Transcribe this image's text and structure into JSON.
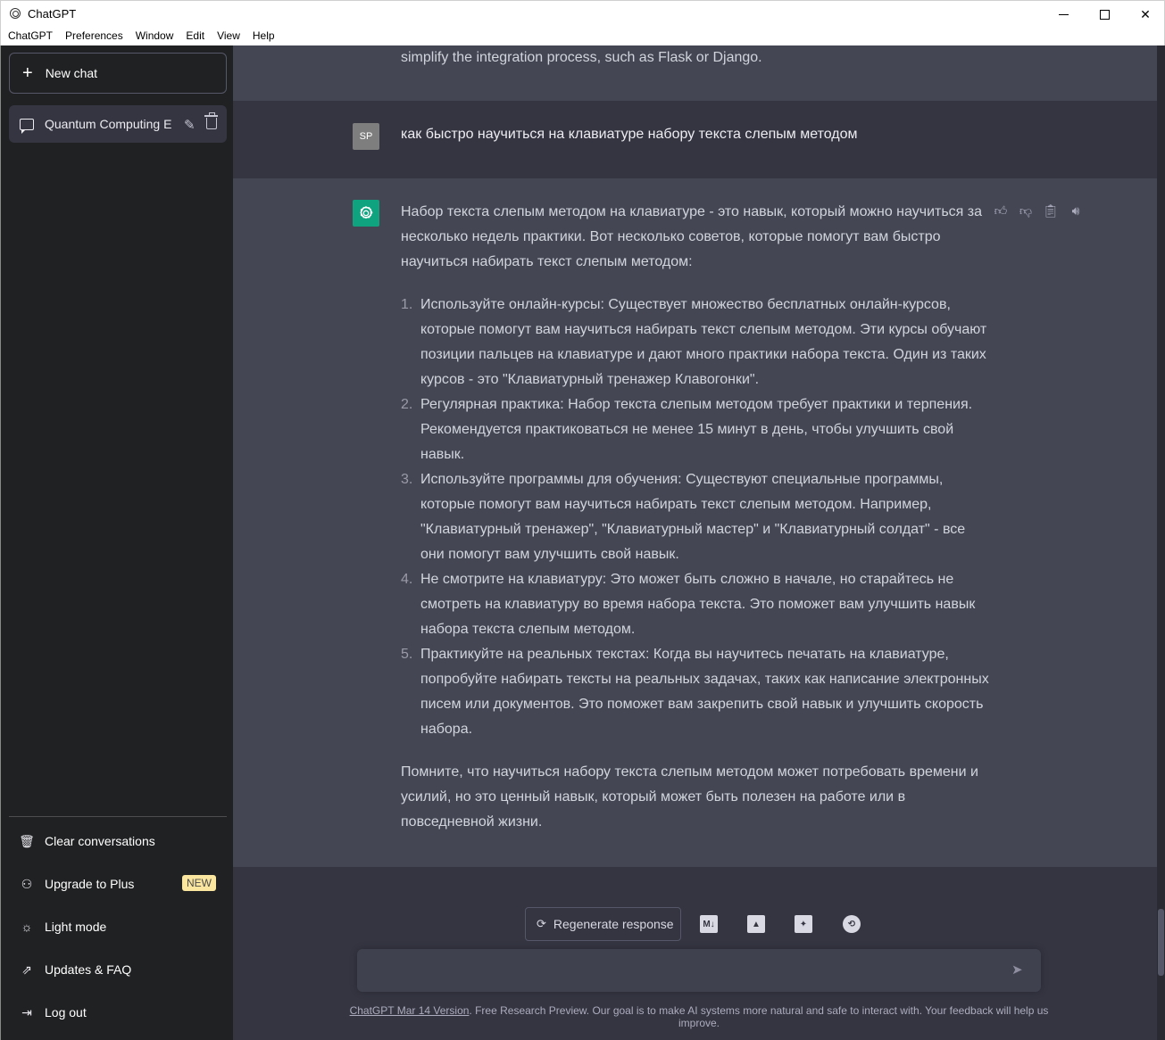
{
  "window": {
    "title": "ChatGPT"
  },
  "menu": [
    "ChatGPT",
    "Preferences",
    "Window",
    "Edit",
    "View",
    "Help"
  ],
  "sidebar": {
    "new_chat": "New chat",
    "chats": [
      {
        "label": "Quantum Computing E"
      }
    ],
    "links": [
      {
        "label": "Clear conversations",
        "icon": "trash-icon"
      },
      {
        "label": "Upgrade to Plus",
        "icon": "user-icon",
        "badge": "NEW"
      },
      {
        "label": "Light mode",
        "icon": "sun-icon"
      },
      {
        "label": "Updates & FAQ",
        "icon": "external-link-icon"
      },
      {
        "label": "Log out",
        "icon": "logout-icon"
      }
    ]
  },
  "conversation": {
    "prev_tail": "simplify the integration process, such as Flask or Django.",
    "user": {
      "avatar": "SP",
      "text": "как быстро научиться на клавиатуре набору текста слепым методом"
    },
    "assistant": {
      "intro": "Набор текста слепым методом на клавиатуре - это навык, который можно научиться за несколько недель практики. Вот несколько советов, которые помогут вам быстро научиться набирать текст слепым методом:",
      "items": [
        {
          "num": "1.",
          "text": "Используйте онлайн-курсы: Существует множество бесплатных онлайн-курсов, которые помогут вам научиться набирать текст слепым методом. Эти курсы обучают позиции пальцев на клавиатуре и дают много практики набора текста. Один из таких курсов - это \"Клавиатурный тренажер Клавогонки\"."
        },
        {
          "num": "2.",
          "text": "Регулярная практика: Набор текста слепым методом требует практики и терпения. Рекомендуется практиковаться не менее 15 минут в день, чтобы улучшить свой навык."
        },
        {
          "num": "3.",
          "text": "Используйте программы для обучения: Существуют специальные программы, которые помогут вам научиться набирать текст слепым методом. Например, \"Клавиатурный тренажер\", \"Клавиатурный мастер\" и \"Клавиатурный солдат\" - все они помогут вам улучшить свой навык."
        },
        {
          "num": "4.",
          "text": "Не смотрите на клавиатуру: Это может быть сложно в начале, но старайтесь не смотреть на клавиатуру во время набора текста. Это поможет вам улучшить навык набора текста слепым методом."
        },
        {
          "num": "5.",
          "text": "Практикуйте на реальных текстах: Когда вы научитесь печатать на клавиатуре, попробуйте набирать тексты на реальных задачах, таких как написание электронных писем или документов. Это поможет вам закрепить свой навык и улучшить скорость набора."
        }
      ],
      "outro": "Помните, что научиться набору текста слепым методом может потребовать времени и усилий, но это ценный навык, который может быть полезен на работе или в повседневной жизни."
    }
  },
  "composer": {
    "regenerate": "Regenerate response",
    "input_value": "",
    "tools": [
      "markdown-icon",
      "image-icon",
      "pdf-icon",
      "sync-icon"
    ]
  },
  "footer": {
    "link": "ChatGPT Mar 14 Version",
    "text": ". Free Research Preview. Our goal is to make AI systems more natural and safe to interact with. Your feedback will help us improve."
  },
  "colors": {
    "sidebar": "#202123",
    "main": "#343541",
    "assistant_bg": "#444654",
    "accent": "#10a37f",
    "badge": "#fae69e"
  }
}
